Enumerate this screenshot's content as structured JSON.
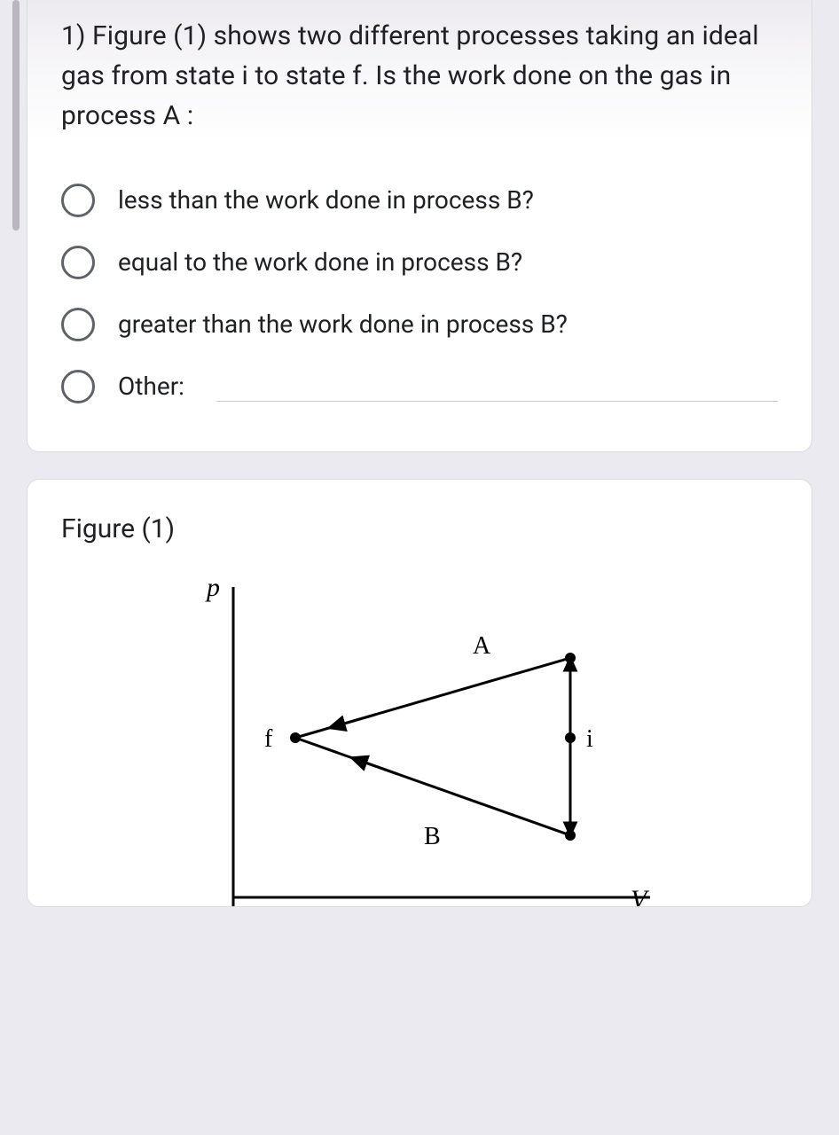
{
  "question": {
    "text": "1) Figure (1) shows two different processes taking an ideal gas from state i to state f. Is the work done on the gas in process A :",
    "options": [
      {
        "label": "less than the work done in process B?"
      },
      {
        "label": "equal to the work done in process B?"
      },
      {
        "label": "greater than the work done in process B?"
      },
      {
        "label": "Other:"
      }
    ]
  },
  "figure": {
    "title": "Figure (1)",
    "y_axis_label": "p",
    "x_axis_label": "V",
    "path_top_label": "A",
    "path_bottom_label": "B",
    "point_left_label": "f",
    "point_right_label": "i"
  }
}
